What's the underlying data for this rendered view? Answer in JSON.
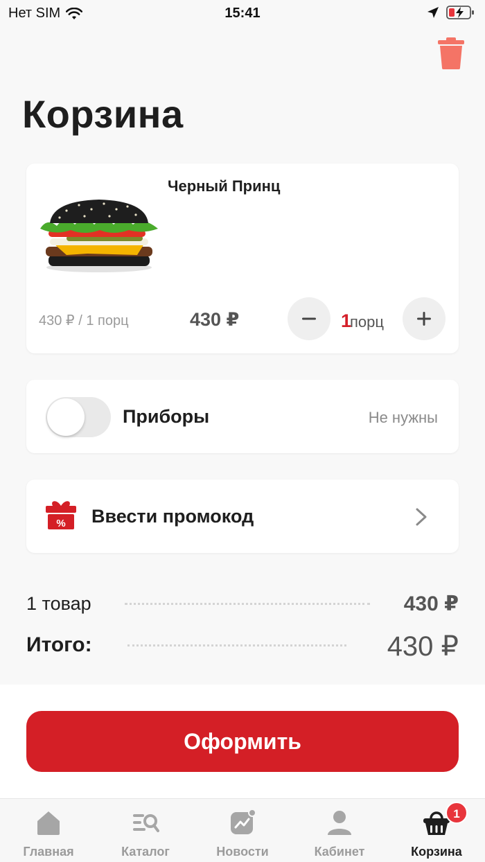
{
  "status_bar": {
    "carrier": "Нет SIM",
    "time": "15:41"
  },
  "page": {
    "title": "Корзина"
  },
  "cart_item": {
    "name": "Черный Принц",
    "unit_price": "430 ₽ / 1 порц",
    "line_total": "430 ₽",
    "quantity": "1",
    "quantity_unit": "порц"
  },
  "cutlery": {
    "label": "Приборы",
    "value": "Не нужны",
    "enabled": false
  },
  "promo": {
    "label": "Ввести промокод"
  },
  "summary": {
    "items_label": "1 товар",
    "items_value": "430 ₽",
    "total_label": "Итого:",
    "total_value": "430 ₽"
  },
  "checkout": {
    "label": "Оформить"
  },
  "tabbar": {
    "tabs": [
      {
        "label": "Главная"
      },
      {
        "label": "Каталог"
      },
      {
        "label": "Новости"
      },
      {
        "label": "Кабинет"
      },
      {
        "label": "Корзина"
      }
    ],
    "cart_badge": "1"
  },
  "colors": {
    "accent": "#d41f26",
    "trash": "#f47466",
    "badge": "#e8353c"
  }
}
